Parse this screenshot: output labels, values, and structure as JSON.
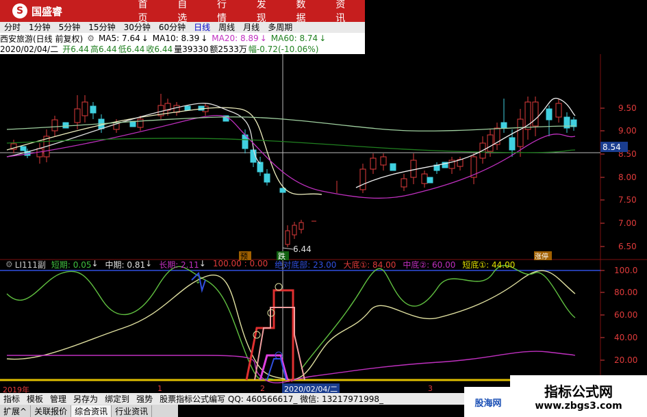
{
  "app": {
    "logo_text": "国盛睿",
    "nav": [
      "首页",
      "自选",
      "行情",
      "发现",
      "数据",
      "资讯"
    ]
  },
  "periods": [
    "分时",
    "1分钟",
    "5分钟",
    "15分钟",
    "30分钟",
    "60分钟",
    "日线",
    "周线",
    "月线",
    "多周期"
  ],
  "active_period": "日线",
  "stock": {
    "name": "西安旅游(日线 前复权)",
    "ma": [
      {
        "label": "MA5: 7.64",
        "color": "#000000"
      },
      {
        "label": "MA10: 8.39",
        "color": "#000000"
      },
      {
        "label": "MA20: 8.89",
        "color": "#c030c0"
      },
      {
        "label": "MA60: 8.74",
        "color": "#208020"
      }
    ],
    "date": "2020/02/04/二",
    "ohlc": [
      {
        "label": "开6.44",
        "color": "#208020"
      },
      {
        "label": "高6.44",
        "color": "#208020"
      },
      {
        "label": "低6.44",
        "color": "#208020"
      },
      {
        "label": "收6.44",
        "color": "#208020"
      },
      {
        "label": "量39330",
        "color": "#000000"
      },
      {
        "label": "额2533万",
        "color": "#000000"
      },
      {
        "label": "幅-0.72(-10.06%)",
        "color": "#208020"
      }
    ]
  },
  "price_axis": [
    "9.50",
    "9.00",
    "8.54",
    "8.50",
    "8.00",
    "7.50",
    "7.00",
    "6.50"
  ],
  "current_price_tag": "8.54",
  "low_annotation": "6.44",
  "markers": {
    "yu": "预",
    "die": "跌",
    "zhang": "涨停"
  },
  "indicator": {
    "name": "LI111副",
    "items": [
      {
        "label": "短期: 0.05",
        "arrow": "↓",
        "color": "#40c040"
      },
      {
        "label": "中期: 0.81",
        "arrow": "↓",
        "color": "#e0e0e0"
      },
      {
        "label": "长期: 2.11",
        "arrow": "↓",
        "color": "#c030c0"
      },
      {
        "label": "100.00 : 0.00",
        "arrow": "",
        "color": "#e03b3b"
      },
      {
        "label": "绝对底部: 23.00",
        "arrow": "",
        "color": "#3050e0"
      },
      {
        "label": "大底①: 84.00",
        "arrow": "",
        "color": "#e03b3b"
      },
      {
        "label": "中底②: 60.00",
        "arrow": "",
        "color": "#c030c0"
      },
      {
        "label": "短底①: 44.00",
        "arrow": "",
        "color": "#e0e000"
      }
    ],
    "axis": [
      "100.0",
      "80.00",
      "60.00",
      "40.00",
      "20.00"
    ]
  },
  "timeline": {
    "year": "2019年",
    "ticks": [
      "1",
      "2",
      "3"
    ],
    "cursor_date": "2020/02/04/二"
  },
  "toolbar": [
    "指标",
    "模板",
    "管理",
    "另存为",
    "绑定到",
    "强势"
  ],
  "toolbar_text": "股票指标公式编写 QQ: 460566617_  微信: 13217971998_",
  "tabs": [
    "扩展^",
    "关联报价",
    "综合资讯",
    "行业资讯"
  ],
  "watermarks": {
    "w1": "股海网",
    "w2a": "指标公式网",
    "w2b": "www.zbgs3.com"
  },
  "colors": {
    "up": "#e03b3b",
    "down": "#40d0e0",
    "nav": "#c61e1e"
  }
}
